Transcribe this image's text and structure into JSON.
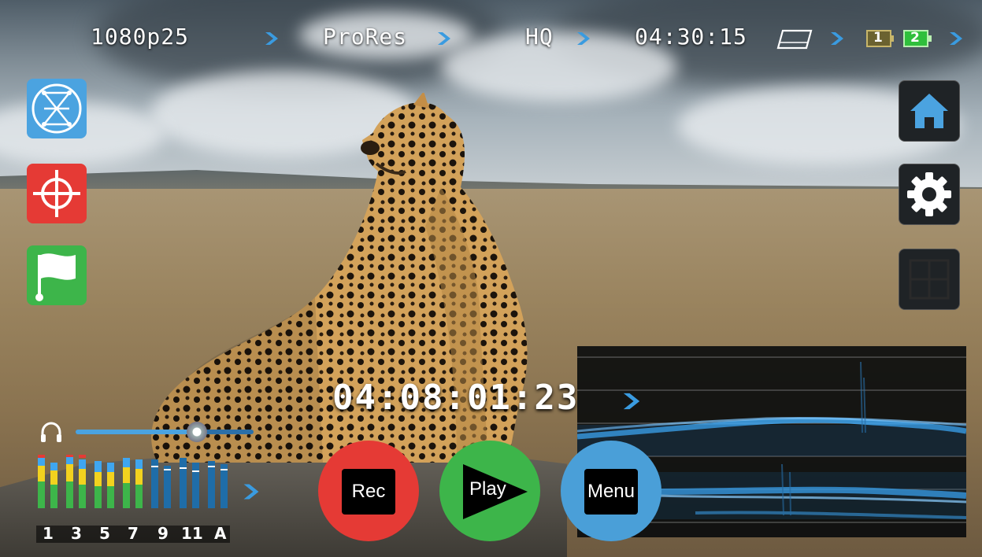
{
  "topbar": {
    "resolution": "1080p25",
    "codec": "ProRes",
    "quality": "HQ",
    "time_remaining": "04:30:15",
    "battery_1": "1",
    "battery_2": "2"
  },
  "left_tools": [
    "focus-peaking-icon",
    "crosshair-icon",
    "flag-icon"
  ],
  "right_tools": [
    "home-icon",
    "settings-gear-icon",
    "grid-icon"
  ],
  "timecode": "04:08:01:23",
  "audio": {
    "volume": 0.68,
    "channel_labels": [
      "1",
      "3",
      "5",
      "7",
      "9",
      "11",
      "A"
    ]
  },
  "transport": {
    "rec_label": "Rec",
    "play_label": "Play",
    "menu_label": "Menu"
  },
  "colors": {
    "accent_blue": "#4ba3e0",
    "rec_red": "#e53a35",
    "play_green": "#3db54a",
    "menu_blue": "#4a9fd8",
    "battery_2": "#2fbf3c"
  }
}
